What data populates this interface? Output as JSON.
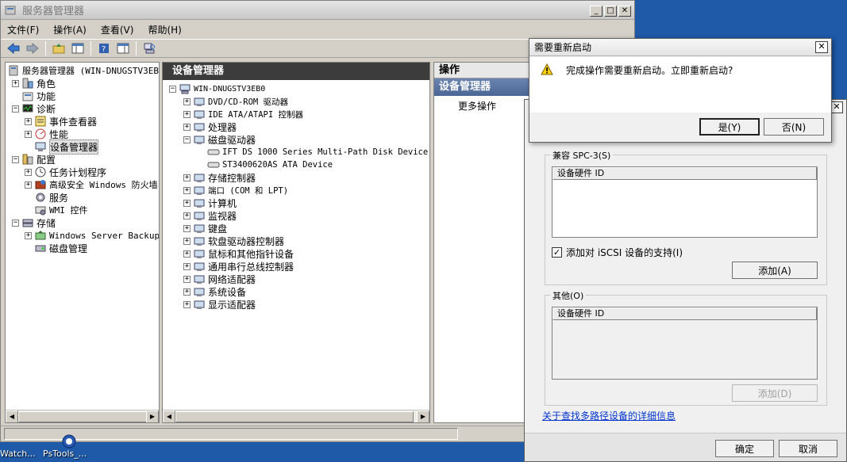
{
  "main_window": {
    "title": "服务器管理器",
    "menu": [
      "文件(F)",
      "操作(A)",
      "查看(V)",
      "帮助(H)"
    ]
  },
  "left_tree": {
    "root": "服务器管理器 (WIN-DNUGSTV3EB",
    "items": [
      {
        "label": "角色",
        "level": 1,
        "expander": "+",
        "icon": "roles-icon"
      },
      {
        "label": "功能",
        "level": 1,
        "expander": "",
        "icon": "features-icon"
      },
      {
        "label": "诊断",
        "level": 1,
        "expander": "-",
        "icon": "diagnostics-icon"
      },
      {
        "label": "事件查看器",
        "level": 2,
        "expander": "+",
        "icon": "event-viewer-icon"
      },
      {
        "label": "性能",
        "level": 2,
        "expander": "+",
        "icon": "performance-icon"
      },
      {
        "label": "设备管理器",
        "level": 2,
        "expander": "",
        "icon": "device-manager-icon",
        "selected": true
      },
      {
        "label": "配置",
        "level": 1,
        "expander": "-",
        "icon": "configuration-icon"
      },
      {
        "label": "任务计划程序",
        "level": 2,
        "expander": "+",
        "icon": "task-scheduler-icon"
      },
      {
        "label": "高级安全 Windows 防火墙",
        "level": 2,
        "expander": "+",
        "icon": "firewall-icon"
      },
      {
        "label": "服务",
        "level": 2,
        "expander": "",
        "icon": "services-icon"
      },
      {
        "label": "WMI 控件",
        "level": 2,
        "expander": "",
        "icon": "wmi-icon"
      },
      {
        "label": "存储",
        "level": 1,
        "expander": "-",
        "icon": "storage-icon"
      },
      {
        "label": "Windows Server Backup",
        "level": 2,
        "expander": "+",
        "icon": "backup-icon"
      },
      {
        "label": "磁盘管理",
        "level": 2,
        "expander": "",
        "icon": "disk-management-icon"
      }
    ]
  },
  "center": {
    "header": "设备管理器",
    "root": "WIN-DNUGSTV3EB0",
    "items": [
      {
        "label": "DVD/CD-ROM 驱动器",
        "level": 1,
        "expander": "+"
      },
      {
        "label": "IDE ATA/ATAPI 控制器",
        "level": 1,
        "expander": "+"
      },
      {
        "label": "处理器",
        "level": 1,
        "expander": "+"
      },
      {
        "label": "磁盘驱动器",
        "level": 1,
        "expander": "-"
      },
      {
        "label": "IFT DS 1000 Series  Multi-Path Disk Device",
        "level": 2,
        "expander": ""
      },
      {
        "label": "ST3400620AS ATA Device",
        "level": 2,
        "expander": ""
      },
      {
        "label": "存储控制器",
        "level": 1,
        "expander": "+"
      },
      {
        "label": "端口 (COM 和 LPT)",
        "level": 1,
        "expander": "+"
      },
      {
        "label": "计算机",
        "level": 1,
        "expander": "+"
      },
      {
        "label": "监视器",
        "level": 1,
        "expander": "+"
      },
      {
        "label": "键盘",
        "level": 1,
        "expander": "+"
      },
      {
        "label": "软盘驱动器控制器",
        "level": 1,
        "expander": "+"
      },
      {
        "label": "鼠标和其他指针设备",
        "level": 1,
        "expander": "+"
      },
      {
        "label": "通用串行总线控制器",
        "level": 1,
        "expander": "+"
      },
      {
        "label": "网络适配器",
        "level": 1,
        "expander": "+"
      },
      {
        "label": "系统设备",
        "level": 1,
        "expander": "+"
      },
      {
        "label": "显示适配器",
        "level": 1,
        "expander": "+"
      }
    ]
  },
  "actions": {
    "header": "操作",
    "section": "设备管理器",
    "more": "更多操作"
  },
  "restart_dialog": {
    "title": "需要重新启动",
    "message": "完成操作需要重新启动。立即重新启动?",
    "yes": "是(Y)",
    "no": "否(N)"
  },
  "mpio_dialog": {
    "spc3_label": "兼容 SPC-3(S)",
    "spc3_list_header": "设备硬件 ID",
    "iscsi_checkbox": "添加对 iSCSI 设备的支持(I)",
    "iscsi_checked": true,
    "add_button": "添加(A)",
    "other_label": "其他(O)",
    "other_list_header": "设备硬件 ID",
    "add_disabled_button": "添加(D)",
    "link": "关于查找多路径设备的详细信息",
    "ok": "确定",
    "cancel": "取消"
  },
  "taskbar": {
    "items": [
      "Watch...",
      "PsTools_..."
    ]
  }
}
